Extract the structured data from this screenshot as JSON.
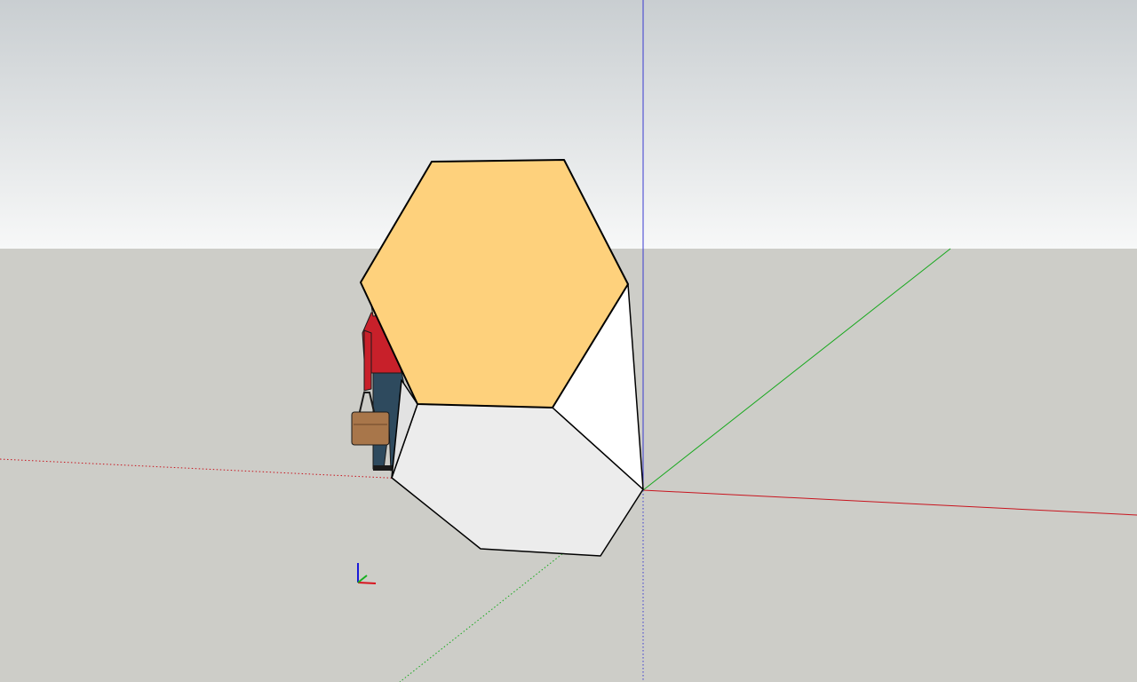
{
  "viewport": {
    "sky_color_top": "#c9ced1",
    "sky_color_bottom": "#f7f8f8",
    "ground_color": "#cdcdc8"
  },
  "axes": {
    "red_axis_color": "#c8141e",
    "green_axis_color": "#16a81c",
    "blue_axis_color": "#3a3ad0"
  },
  "model": {
    "shape": "hexagonal-prism",
    "top_face_color": "#fed17c",
    "side_face_light_color": "#ffffff",
    "side_face_gray_color": "#ececec",
    "edge_color": "#000000"
  },
  "figure": {
    "shirt_color": "#c8202a",
    "pants_color": "#2e4a5e",
    "bag_color": "#a8764a"
  }
}
